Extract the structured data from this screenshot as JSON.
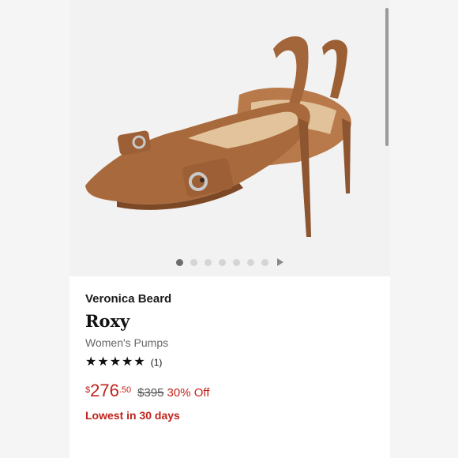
{
  "product": {
    "brand": "Veronica Beard",
    "name": "Roxy",
    "category": "Women's Pumps",
    "rating": {
      "stars": 5,
      "count_label": "(1)"
    },
    "price": {
      "currency": "$",
      "dollars": "276",
      "cents": ".50",
      "original": "$395",
      "discount": "30% Off"
    },
    "price_note": "Lowest in 30 days"
  },
  "carousel": {
    "total_images": 7,
    "active_index": 0,
    "play_icon": "play-triangle-icon"
  },
  "colors": {
    "suede": "#a86a3d",
    "price_red": "#c0231b",
    "background": "#f5f5f5"
  }
}
